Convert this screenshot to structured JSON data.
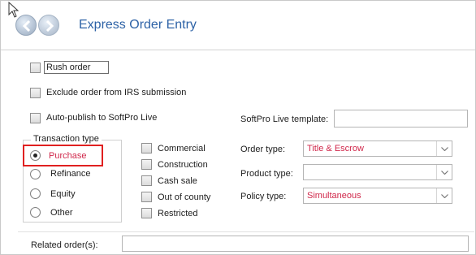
{
  "header": {
    "title": "Express Order Entry"
  },
  "options": {
    "rush_order": "Rush order",
    "exclude_irs": "Exclude order from IRS submission",
    "auto_publish": "Auto-publish to SoftPro Live"
  },
  "softpro_live": {
    "template_label": "SoftPro Live template:",
    "template_value": ""
  },
  "transaction_type": {
    "legend": "Transaction type",
    "options": [
      "Purchase",
      "Refinance",
      "Equity",
      "Other"
    ],
    "selected": "Purchase"
  },
  "property_flags": [
    "Commercial",
    "Construction",
    "Cash sale",
    "Out of county",
    "Restricted"
  ],
  "order_type": {
    "label": "Order type:",
    "value": "Title & Escrow"
  },
  "product_type": {
    "label": "Product type:",
    "value": ""
  },
  "policy_type": {
    "label": "Policy type:",
    "value": "Simultaneous"
  },
  "related_orders": {
    "label": "Related order(s):",
    "value": ""
  },
  "colors": {
    "title": "#2d62a6",
    "selected_value": "#d0274a",
    "highlight_border": "#e02020"
  }
}
